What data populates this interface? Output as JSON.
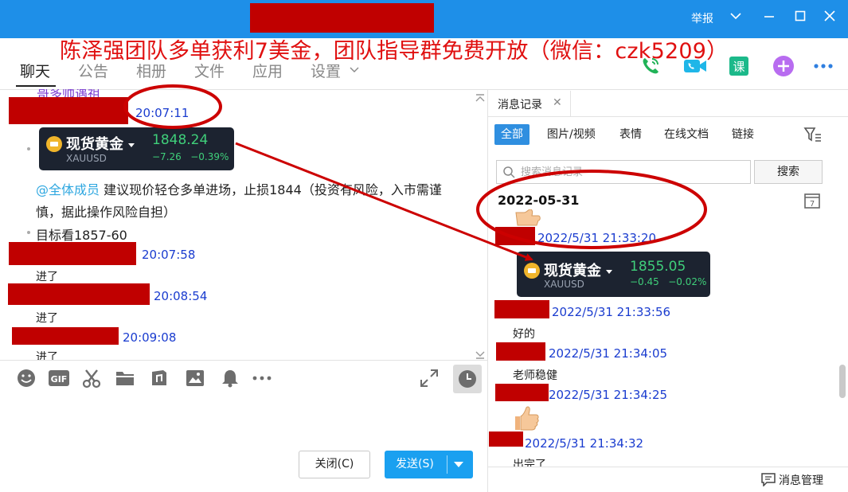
{
  "window": {
    "report_label": "举报",
    "promo_text": "陈泽强团队多单获利7美金，团队指导群免费开放（微信：czk5209）"
  },
  "tabs": [
    {
      "label": "聊天"
    },
    {
      "label": "公告"
    },
    {
      "label": "相册"
    },
    {
      "label": "文件"
    },
    {
      "label": "应用"
    },
    {
      "label": "设置"
    }
  ],
  "chat": {
    "partial_top_text": "哥多帅遇祖",
    "messages": [
      {
        "time": "20:07:11"
      },
      {
        "time": "20:07:58",
        "text": "进了"
      },
      {
        "time": "20:08:54",
        "text": "进了"
      },
      {
        "time": "20:09:08",
        "text": "进了"
      }
    ],
    "gold_card": {
      "name": "现货黄金",
      "symbol": "XAUUSD",
      "price": "1848.24",
      "change": "−7.26",
      "change_pct": "−0.39%"
    },
    "mention": "@全体成员",
    "advice_line1": " 建议现价轻仓多单进场，止损1844（投资有风险，入市需谨",
    "advice_line2": "慎，据此操作风险自担）",
    "target_text": "目标看1857-60"
  },
  "toolbar": {
    "close_label": "关闭(C)",
    "send_label": "发送(S)"
  },
  "history": {
    "tab_label": "消息记录",
    "filters": [
      {
        "label": "全部"
      },
      {
        "label": "图片/视频"
      },
      {
        "label": "表情"
      },
      {
        "label": "在线文档"
      },
      {
        "label": "链接"
      }
    ],
    "search_placeholder": "搜索消息记录",
    "search_button": "搜索",
    "date": "2022-05-31",
    "calendar_day": "7",
    "entries": [
      {
        "time": "2022/5/31 21:33:20"
      },
      {
        "time": "2022/5/31 21:33:56",
        "text": "好的"
      },
      {
        "time": "2022/5/31 21:34:05",
        "text": "老师稳健"
      },
      {
        "time": "2022/5/31 21:34:25"
      },
      {
        "time": "2022/5/31 21:34:32",
        "text": "出完了"
      }
    ],
    "gold_card": {
      "name": "现货黄金",
      "symbol": "XAUUSD",
      "price": "1855.05",
      "change": "−0.45",
      "change_pct": "−0.02%"
    },
    "manage_label": "消息管理"
  },
  "colors": {
    "titlebar": "#1e8fe8",
    "redaction": "#c00000",
    "annotation_red": "#cc0000",
    "timestamp_blue": "#1a3ccf",
    "price_green": "#3fcf7a",
    "send_button": "#1aa0f0"
  }
}
